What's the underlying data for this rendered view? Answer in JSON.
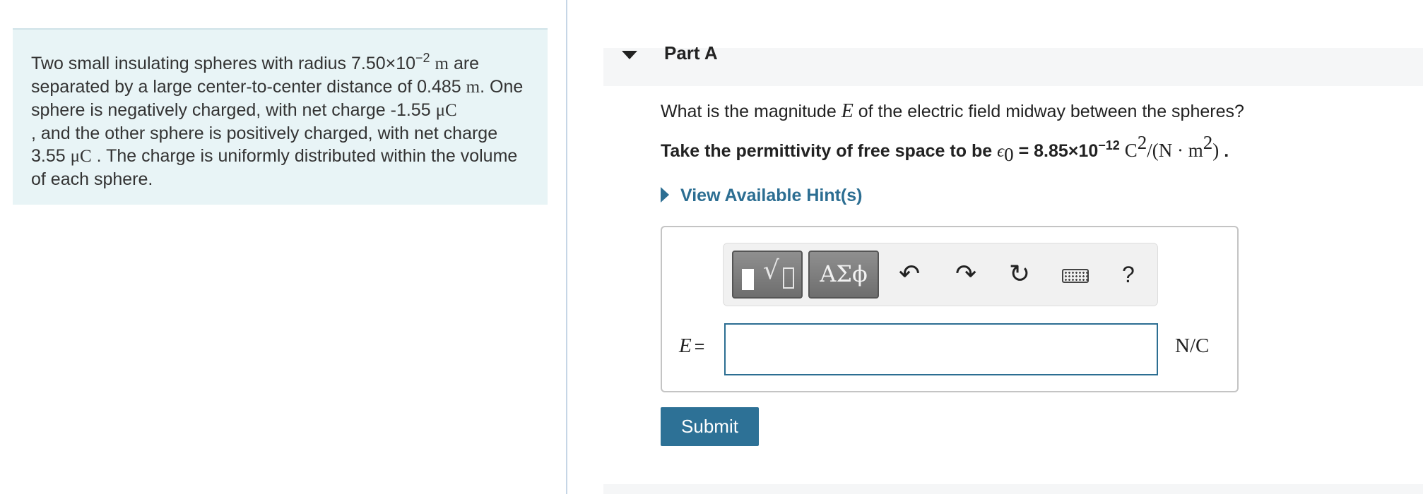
{
  "problem": {
    "t1": "Two small insulating spheres with radius 7.50×10",
    "radius_exp": "−2",
    "unit_m": "m",
    "t2": "are separated by a large center-to-center distance of 0.485",
    "t3": ". One sphere is negatively charged, with net charge -1.55",
    "unit_uC": "μC",
    "t4": ", and the other sphere is positively charged, with net charge 3.55",
    "t5": ". The charge is uniformly distributed within the volume of each sphere."
  },
  "part": {
    "title": "Part A"
  },
  "question": {
    "pre": "What is the magnitude",
    "var": "E",
    "post": "of the electric field midway between the spheres?"
  },
  "permittivity": {
    "pre": "Take the permittivity of free space to be",
    "symbol": "ϵ",
    "symbol_sub": "0",
    "value": "= 8.85×10",
    "exp": "−12",
    "unit_a": "C",
    "unit_a_exp": "2",
    "unit_b": "/(N · m",
    "unit_b_exp": "2",
    "unit_c": ")",
    "end": "."
  },
  "hint": {
    "label": "View Available Hint(s)"
  },
  "toolbar": {
    "greek_label": "ΑΣϕ",
    "help_label": "?",
    "icons": [
      "templates-icon",
      "greek-letters-icon",
      "undo-icon",
      "redo-icon",
      "reset-icon",
      "keyboard-icon",
      "help-icon"
    ]
  },
  "answer": {
    "variable": "E",
    "equals": "=",
    "value": "",
    "unit": "N/C"
  },
  "submit": {
    "label": "Submit"
  },
  "colors": {
    "accent": "#2c6e92",
    "problem_bg": "#e8f4f6",
    "submit_bg": "#2d7196"
  }
}
